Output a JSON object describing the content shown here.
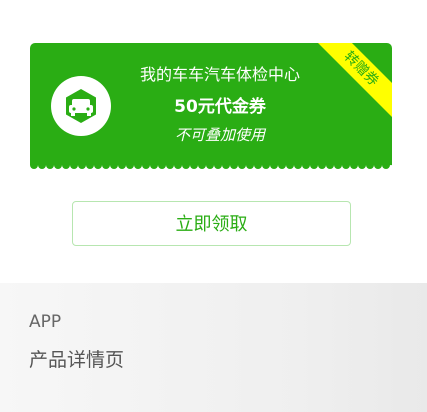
{
  "coupon": {
    "merchant": "我的车车汽车体检中心",
    "amount": "50元代金券",
    "rule": "不可叠加使用",
    "ribbon": "转赠券",
    "icon": "car-icon",
    "color": "#2aad14",
    "ribbon_color": "#ffff00"
  },
  "claim_button": {
    "label": "立即领取"
  },
  "footer": {
    "app_label": "APP",
    "page_label": "产品详情页"
  }
}
